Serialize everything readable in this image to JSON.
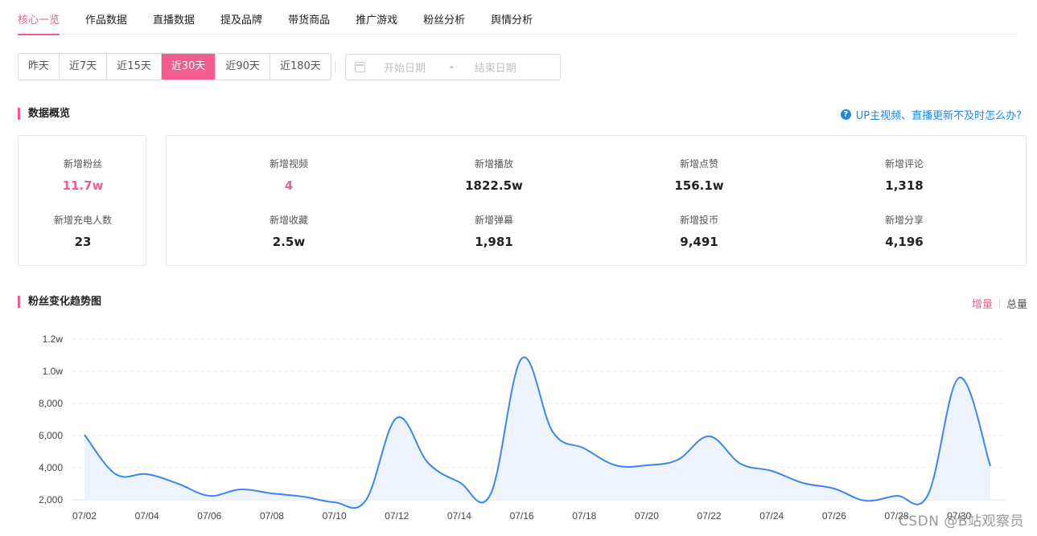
{
  "tabs": [
    "核心一览",
    "作品数据",
    "直播数据",
    "提及品牌",
    "带货商品",
    "推广游戏",
    "粉丝分析",
    "舆情分析"
  ],
  "active_tab": 0,
  "ranges": [
    "昨天",
    "近7天",
    "近15天",
    "近30天",
    "近90天",
    "近180天"
  ],
  "active_range": 3,
  "date_range": {
    "start_placeholder": "开始日期",
    "dash": "-",
    "end_placeholder": "结束日期"
  },
  "overview": {
    "title": "数据概览",
    "help_text": "UP主视频、直播更新不及时怎么办?",
    "help_icon": "?",
    "left_stats": [
      {
        "label": "新增粉丝",
        "value": "11.7w",
        "highlight": true
      },
      {
        "label": "新增充电人数",
        "value": "23",
        "highlight": false
      }
    ],
    "right_stats": [
      {
        "label": "新增视频",
        "value": "4",
        "highlight": true
      },
      {
        "label": "新增播放",
        "value": "1822.5w",
        "highlight": false
      },
      {
        "label": "新增点赞",
        "value": "156.1w",
        "highlight": false
      },
      {
        "label": "新增评论",
        "value": "1,318",
        "highlight": false
      },
      {
        "label": "新增收藏",
        "value": "2.5w",
        "highlight": false
      },
      {
        "label": "新增弹幕",
        "value": "1,981",
        "highlight": false
      },
      {
        "label": "新增投币",
        "value": "9,491",
        "highlight": false
      },
      {
        "label": "新增分享",
        "value": "4,196",
        "highlight": false
      }
    ]
  },
  "trend": {
    "title": "粉丝变化趋势图",
    "toggle": [
      "增量",
      "总量"
    ],
    "active_toggle": 0
  },
  "watermark": "CSDN @B站观察员",
  "chart_data": {
    "type": "area",
    "title": "粉丝变化趋势图",
    "xlabel": "",
    "ylabel": "",
    "x": [
      "07/02",
      "07/03",
      "07/04",
      "07/05",
      "07/06",
      "07/07",
      "07/08",
      "07/09",
      "07/10",
      "07/11",
      "07/12",
      "07/13",
      "07/14",
      "07/15",
      "07/16",
      "07/17",
      "07/18",
      "07/19",
      "07/20",
      "07/21",
      "07/22",
      "07/23",
      "07/24",
      "07/25",
      "07/26",
      "07/27",
      "07/28",
      "07/29",
      "07/30",
      "07/31"
    ],
    "x_tick_labels": [
      "07/02",
      "07/04",
      "07/06",
      "07/08",
      "07/10",
      "07/12",
      "07/14",
      "07/16",
      "07/18",
      "07/20",
      "07/22",
      "07/24",
      "07/26",
      "07/28",
      "07/30"
    ],
    "series": [
      {
        "values": [
          6050,
          3600,
          3600,
          3000,
          2250,
          2650,
          2400,
          2200,
          1850,
          1950,
          7100,
          4300,
          3100,
          2350,
          10800,
          6200,
          5200,
          4150,
          4150,
          4500,
          5950,
          4250,
          3800,
          3050,
          2700,
          1950,
          2250,
          2300,
          9600,
          4100
        ]
      }
    ],
    "y_ticks": [
      "2,000",
      "4,000",
      "6,000",
      "8,000",
      "1.0w",
      "1.2w"
    ],
    "ylim": [
      2000,
      12000
    ],
    "grid": true,
    "colors": {
      "line": "#3b86f0",
      "fill": "#eef4fd",
      "grid": "#e5e5e5"
    }
  },
  "colors": {
    "accent": "#f25d8e",
    "link": "#1e88e5"
  }
}
